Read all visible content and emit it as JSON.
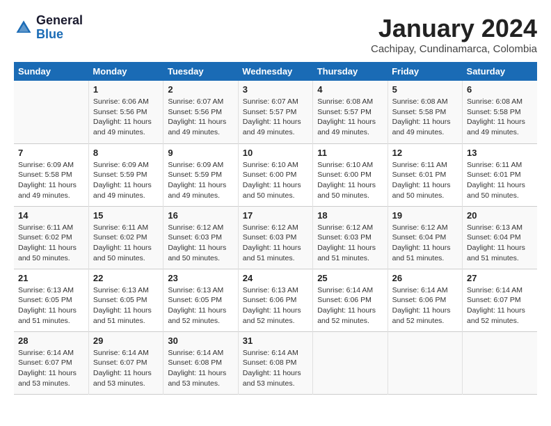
{
  "logo": {
    "line1": "General",
    "line2": "Blue"
  },
  "title": "January 2024",
  "location": "Cachipay, Cundinamarca, Colombia",
  "days_of_week": [
    "Sunday",
    "Monday",
    "Tuesday",
    "Wednesday",
    "Thursday",
    "Friday",
    "Saturday"
  ],
  "weeks": [
    [
      {
        "day": "",
        "info": ""
      },
      {
        "day": "1",
        "info": "Sunrise: 6:06 AM\nSunset: 5:56 PM\nDaylight: 11 hours\nand 49 minutes."
      },
      {
        "day": "2",
        "info": "Sunrise: 6:07 AM\nSunset: 5:56 PM\nDaylight: 11 hours\nand 49 minutes."
      },
      {
        "day": "3",
        "info": "Sunrise: 6:07 AM\nSunset: 5:57 PM\nDaylight: 11 hours\nand 49 minutes."
      },
      {
        "day": "4",
        "info": "Sunrise: 6:08 AM\nSunset: 5:57 PM\nDaylight: 11 hours\nand 49 minutes."
      },
      {
        "day": "5",
        "info": "Sunrise: 6:08 AM\nSunset: 5:58 PM\nDaylight: 11 hours\nand 49 minutes."
      },
      {
        "day": "6",
        "info": "Sunrise: 6:08 AM\nSunset: 5:58 PM\nDaylight: 11 hours\nand 49 minutes."
      }
    ],
    [
      {
        "day": "7",
        "info": "Sunrise: 6:09 AM\nSunset: 5:58 PM\nDaylight: 11 hours\nand 49 minutes."
      },
      {
        "day": "8",
        "info": "Sunrise: 6:09 AM\nSunset: 5:59 PM\nDaylight: 11 hours\nand 49 minutes."
      },
      {
        "day": "9",
        "info": "Sunrise: 6:09 AM\nSunset: 5:59 PM\nDaylight: 11 hours\nand 49 minutes."
      },
      {
        "day": "10",
        "info": "Sunrise: 6:10 AM\nSunset: 6:00 PM\nDaylight: 11 hours\nand 50 minutes."
      },
      {
        "day": "11",
        "info": "Sunrise: 6:10 AM\nSunset: 6:00 PM\nDaylight: 11 hours\nand 50 minutes."
      },
      {
        "day": "12",
        "info": "Sunrise: 6:11 AM\nSunset: 6:01 PM\nDaylight: 11 hours\nand 50 minutes."
      },
      {
        "day": "13",
        "info": "Sunrise: 6:11 AM\nSunset: 6:01 PM\nDaylight: 11 hours\nand 50 minutes."
      }
    ],
    [
      {
        "day": "14",
        "info": "Sunrise: 6:11 AM\nSunset: 6:02 PM\nDaylight: 11 hours\nand 50 minutes."
      },
      {
        "day": "15",
        "info": "Sunrise: 6:11 AM\nSunset: 6:02 PM\nDaylight: 11 hours\nand 50 minutes."
      },
      {
        "day": "16",
        "info": "Sunrise: 6:12 AM\nSunset: 6:03 PM\nDaylight: 11 hours\nand 50 minutes."
      },
      {
        "day": "17",
        "info": "Sunrise: 6:12 AM\nSunset: 6:03 PM\nDaylight: 11 hours\nand 51 minutes."
      },
      {
        "day": "18",
        "info": "Sunrise: 6:12 AM\nSunset: 6:03 PM\nDaylight: 11 hours\nand 51 minutes."
      },
      {
        "day": "19",
        "info": "Sunrise: 6:12 AM\nSunset: 6:04 PM\nDaylight: 11 hours\nand 51 minutes."
      },
      {
        "day": "20",
        "info": "Sunrise: 6:13 AM\nSunset: 6:04 PM\nDaylight: 11 hours\nand 51 minutes."
      }
    ],
    [
      {
        "day": "21",
        "info": "Sunrise: 6:13 AM\nSunset: 6:05 PM\nDaylight: 11 hours\nand 51 minutes."
      },
      {
        "day": "22",
        "info": "Sunrise: 6:13 AM\nSunset: 6:05 PM\nDaylight: 11 hours\nand 51 minutes."
      },
      {
        "day": "23",
        "info": "Sunrise: 6:13 AM\nSunset: 6:05 PM\nDaylight: 11 hours\nand 52 minutes."
      },
      {
        "day": "24",
        "info": "Sunrise: 6:13 AM\nSunset: 6:06 PM\nDaylight: 11 hours\nand 52 minutes."
      },
      {
        "day": "25",
        "info": "Sunrise: 6:14 AM\nSunset: 6:06 PM\nDaylight: 11 hours\nand 52 minutes."
      },
      {
        "day": "26",
        "info": "Sunrise: 6:14 AM\nSunset: 6:06 PM\nDaylight: 11 hours\nand 52 minutes."
      },
      {
        "day": "27",
        "info": "Sunrise: 6:14 AM\nSunset: 6:07 PM\nDaylight: 11 hours\nand 52 minutes."
      }
    ],
    [
      {
        "day": "28",
        "info": "Sunrise: 6:14 AM\nSunset: 6:07 PM\nDaylight: 11 hours\nand 53 minutes."
      },
      {
        "day": "29",
        "info": "Sunrise: 6:14 AM\nSunset: 6:07 PM\nDaylight: 11 hours\nand 53 minutes."
      },
      {
        "day": "30",
        "info": "Sunrise: 6:14 AM\nSunset: 6:08 PM\nDaylight: 11 hours\nand 53 minutes."
      },
      {
        "day": "31",
        "info": "Sunrise: 6:14 AM\nSunset: 6:08 PM\nDaylight: 11 hours\nand 53 minutes."
      },
      {
        "day": "",
        "info": ""
      },
      {
        "day": "",
        "info": ""
      },
      {
        "day": "",
        "info": ""
      }
    ]
  ]
}
